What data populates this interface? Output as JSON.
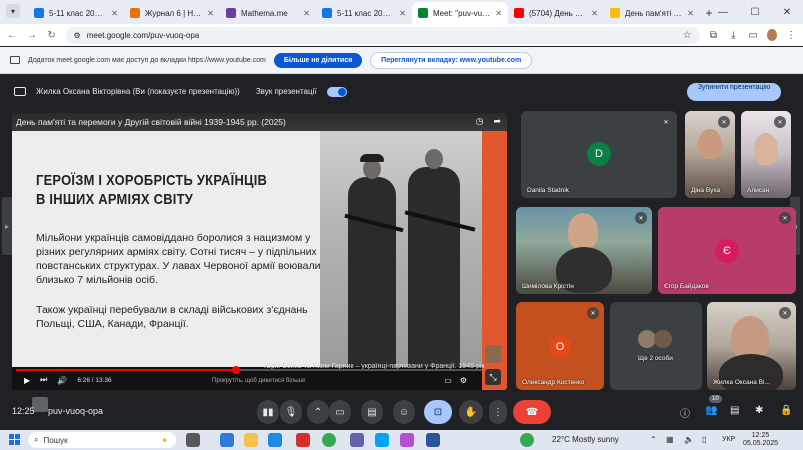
{
  "browser": {
    "tabs": [
      {
        "title": "5-11 клас 2024 (2).do",
        "color": "#1a73e8"
      },
      {
        "title": "Журнал 6 | Нові знан",
        "color": "#e8710a"
      },
      {
        "title": "Mathema.me",
        "color": "#6b3fa0"
      },
      {
        "title": "5-11 клас 2024 (2).do",
        "color": "#1a73e8"
      },
      {
        "title": "Meet: \"puv-vuoq",
        "color": "#00832d"
      },
      {
        "title": "(5704) День пам'ят",
        "color": "#ff0000"
      },
      {
        "title": "День пам'яті та прим",
        "color": "#fbbc04"
      }
    ],
    "new_tab": "+",
    "url": "meet.google.com/puv-vuoq-opa",
    "win_min": "—",
    "win_max": "☐",
    "win_close": "✕"
  },
  "infobar": {
    "text": "Додаток meet.google.com має доступ до вкладки https://www.youtube.com",
    "stop_sharing_label": "Більше не ділитися",
    "view_tab_label": "Переглянути вкладку: www.youtube.com"
  },
  "presenting": {
    "presenter_text": "Жилка Оксана Вікторівна (Ви (показуєте презентацію))",
    "sound_label": "Звук презентації",
    "stop_label": "Зупинити презентацію"
  },
  "video": {
    "title": "День пам'яті та перемоги у Другій світовій війні 1939-1945 рр. (2025)",
    "heading_line1": "ГЕРОЇЗМ І ХОРОБРІСТЬ УКРАЇНЦІВ",
    "heading_line2": "В ІНШИХ АРМІЯХ СВІТУ",
    "paragraph1": "Мільйони українців самовіддано боролися з нацизмом у різних регулярних арміях світу. Сотні тисяч – у підпільних і повстанських структурах. У лавах Червоної армії воювали близько 7 мільйонів осіб.",
    "paragraph2": "Також українці перебували в складі військових з'єднань Польщі, США, Канади, Франції.",
    "caption": "Юрій Бойко та Яким Гарник – українці-партизани у Франції. 1945 рік",
    "scroll_hint": "Прокрутіть, щоб дивитися більше",
    "time": "6:26 / 13:36",
    "progress_fraction": 0.473
  },
  "participants": [
    {
      "name": "Danila Stadnik",
      "initial": "D",
      "color": "#0b8043",
      "muted": true
    },
    {
      "name": "Діна Вуха",
      "muted": true
    },
    {
      "name": "Алисан",
      "muted": true
    },
    {
      "name": "Шимілова Крістін",
      "muted": true
    },
    {
      "name": "Єгор Байдаков",
      "initial": "Є",
      "color": "#c2185b",
      "muted": true
    },
    {
      "name": "Олександр Костенко",
      "initial": "О",
      "color": "#d84315",
      "muted": true
    },
    {
      "name": "Ще 2 особи"
    },
    {
      "name": "Жилка Оксана Ві...",
      "muted": true
    }
  ],
  "meetbar": {
    "time": "12:25",
    "code": "puv-vuoq-opa",
    "people_count": "10"
  },
  "taskbar": {
    "search_placeholder": "Пошук",
    "weather": "22°C  Mostly sunny",
    "lang": "УКР",
    "clock_time": "12:25",
    "clock_date": "05.05.2025"
  }
}
